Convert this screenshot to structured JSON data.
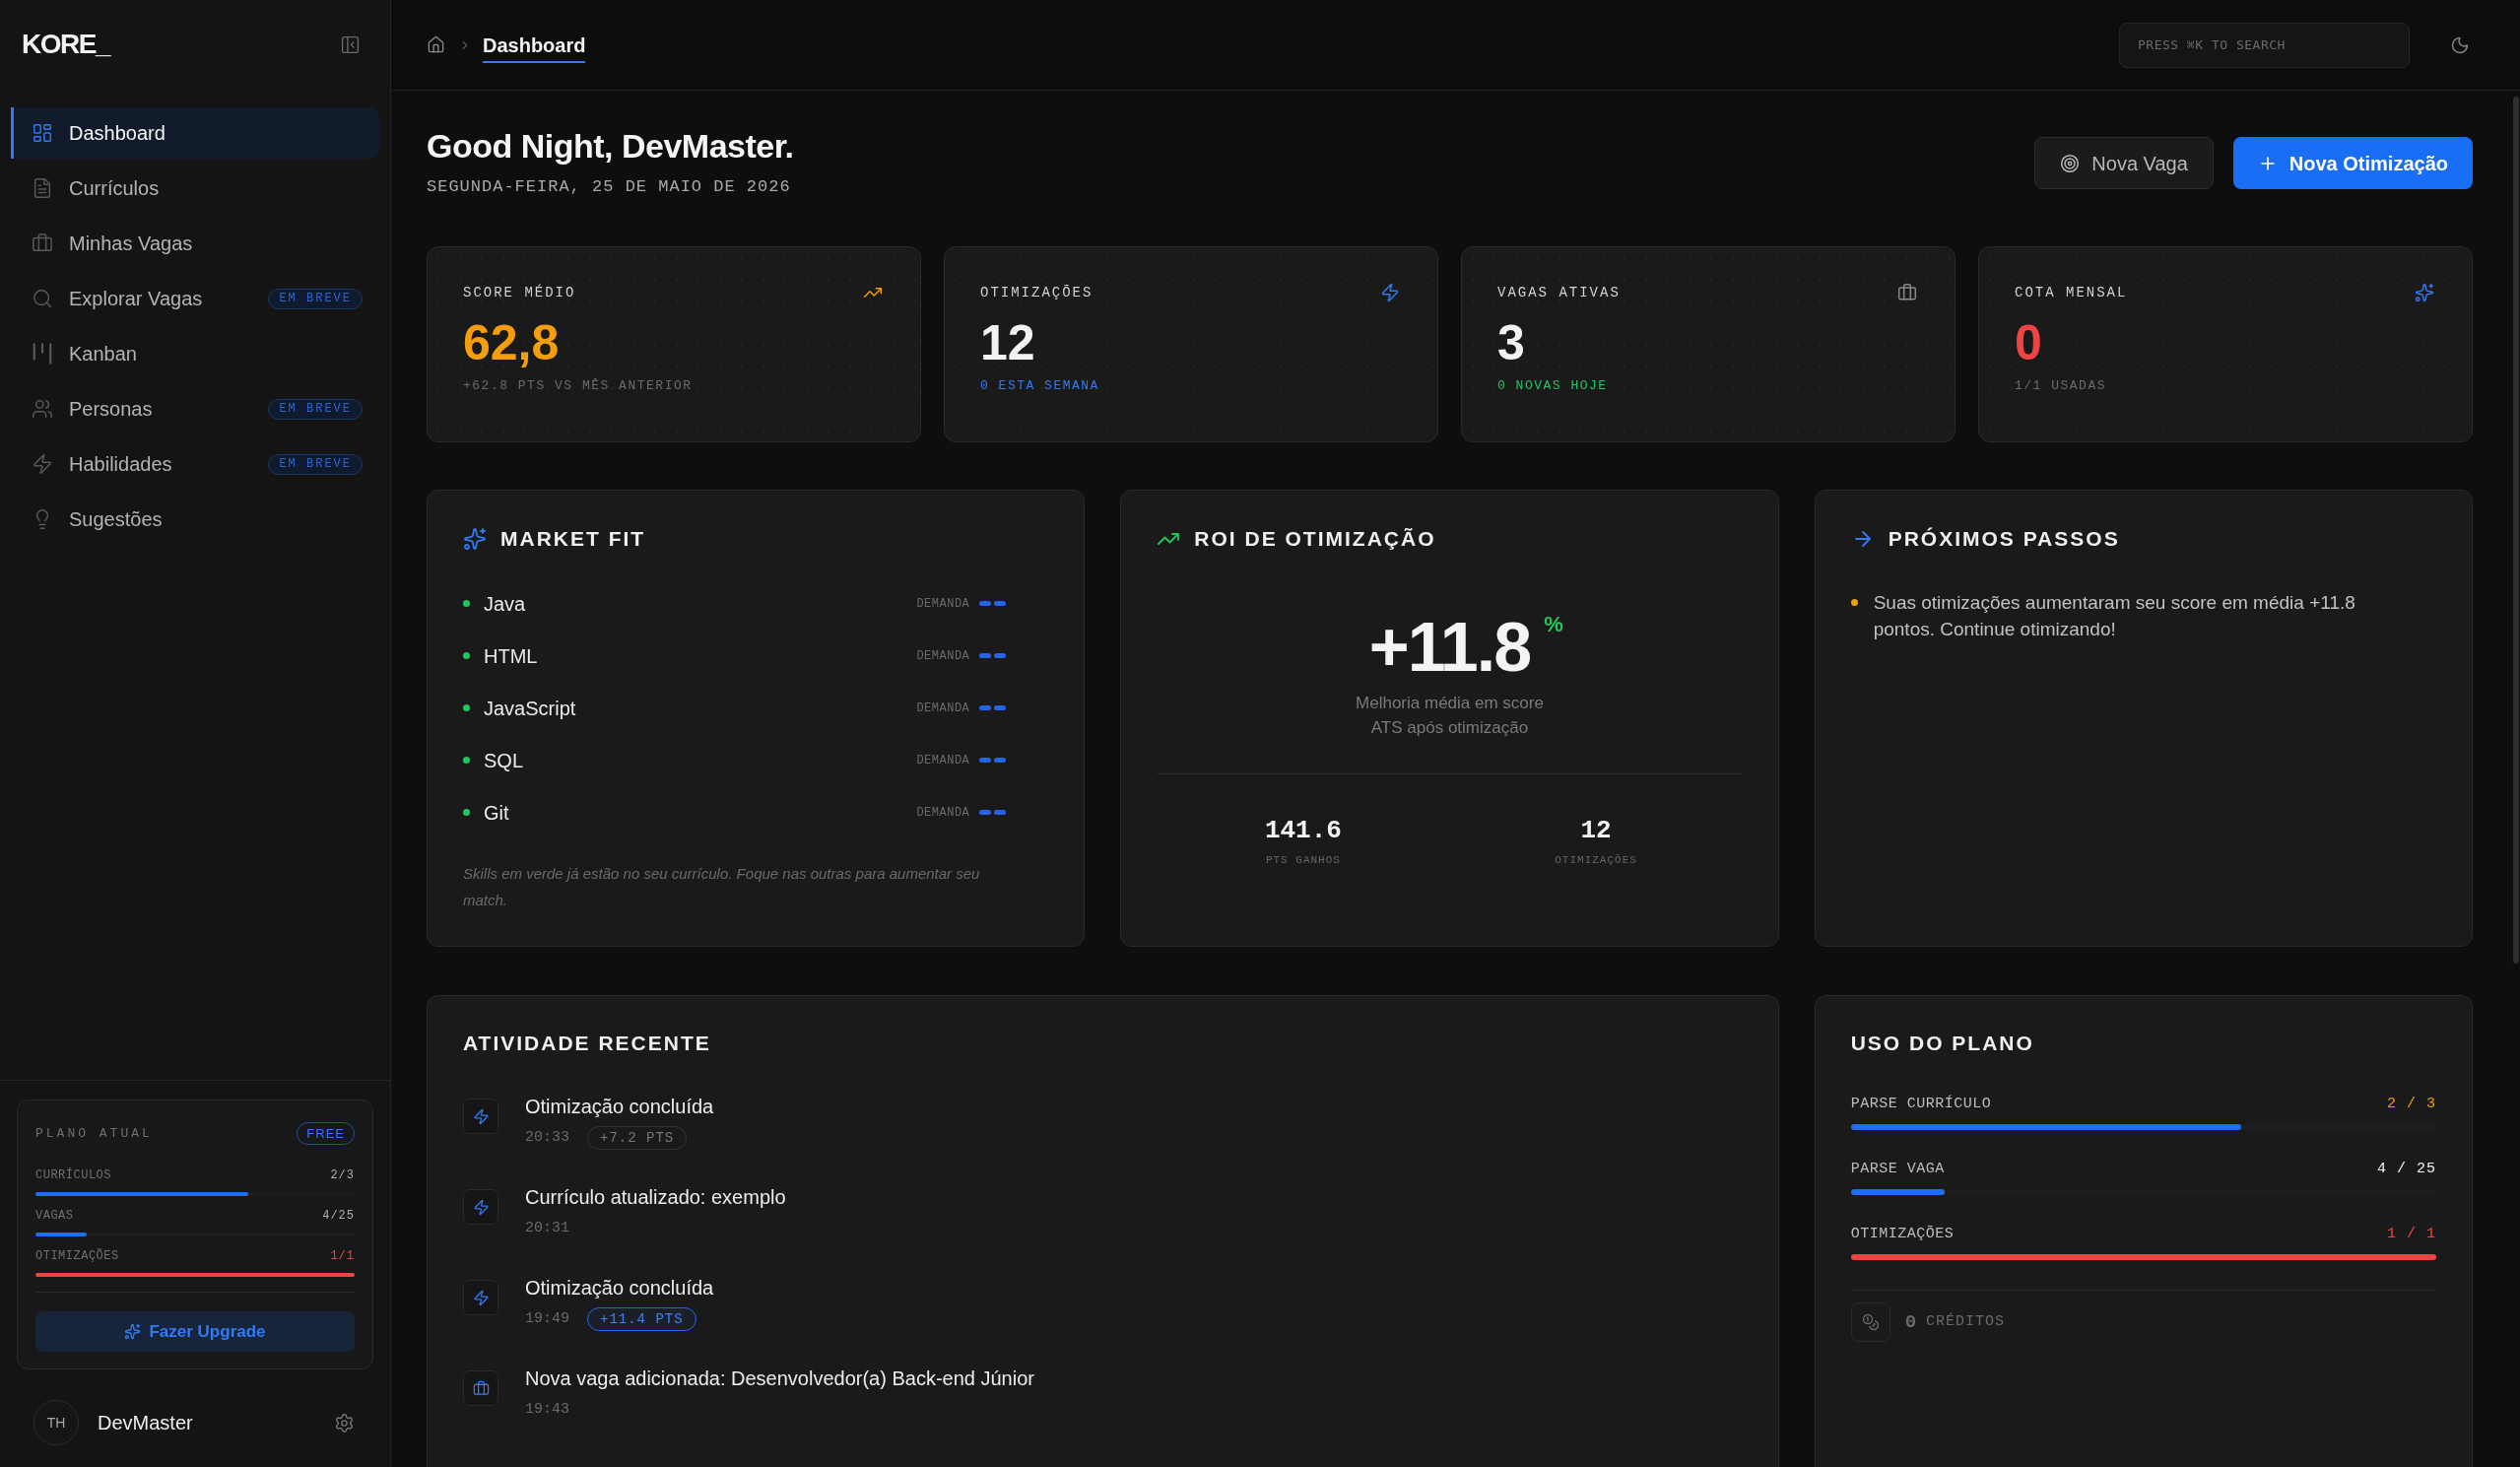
{
  "sidebar": {
    "logo": "KORE_",
    "nav_items": [
      {
        "label": "Dashboard",
        "selected": true
      },
      {
        "label": "Currículos",
        "selected": false
      },
      {
        "label": "Minhas Vagas",
        "selected": false
      },
      {
        "label": "Explorar Vagas",
        "selected": false,
        "badge": "EM BREVE"
      },
      {
        "label": "Kanban",
        "selected": false
      },
      {
        "label": "Personas",
        "selected": false,
        "badge": "EM BREVE"
      },
      {
        "label": "Habilidades",
        "selected": false,
        "badge": "EM BREVE"
      },
      {
        "label": "Sugestões",
        "selected": false
      }
    ],
    "plan_card": {
      "title": "PLANO ATUAL",
      "plan_badge": "FREE",
      "usage": [
        {
          "label": "CURRÍCULOS",
          "value": "2/3",
          "level": 0.667,
          "at_limit": false
        },
        {
          "label": "VAGAS",
          "value": "4/25",
          "level": 0.16,
          "at_limit": false
        },
        {
          "label": "OTIMIZAÇÕES",
          "value": "1/1",
          "level": 1,
          "at_limit": true
        }
      ],
      "upgrade_button": "Fazer Upgrade"
    },
    "user": {
      "initials": "TH",
      "name": "DevMaster"
    }
  },
  "header": {
    "breadcrumb_current": "Dashboard",
    "search": {
      "placeholder": "PRESS ⌘K TO SEARCH"
    }
  },
  "greeting": {
    "title": "Good Night, DevMaster.",
    "date": "SEGUNDA-FEIRA, 25 DE MAIO DE 2026"
  },
  "actions": [
    {
      "label": "Nova Vaga",
      "kind": "secondary"
    },
    {
      "label": "Nova Otimização",
      "kind": "primary"
    }
  ],
  "stats": [
    {
      "kind": "score",
      "label": "SCORE MÉDIO",
      "value": "62,8",
      "note": "+62.8 PTS VS MÊS ANTERIOR"
    },
    {
      "kind": "optimizations",
      "label": "OTIMIZAÇÕES",
      "value": "12",
      "note": "0 ESTA SEMANA"
    },
    {
      "kind": "jobs",
      "label": "VAGAS ATIVAS",
      "value": "3",
      "note": "0 NOVAS HOJE"
    },
    {
      "kind": "quota",
      "label": "COTA MENSAL",
      "value": "0",
      "note": "1/1 USADAS"
    }
  ],
  "market_fit": {
    "title": "MARKET FIT",
    "skills": [
      {
        "name": "Java",
        "in_resume": true,
        "demand_label": "DEMANDA"
      },
      {
        "name": "HTML",
        "in_resume": true,
        "demand_label": "DEMANDA"
      },
      {
        "name": "JavaScript",
        "in_resume": true,
        "demand_label": "DEMANDA"
      },
      {
        "name": "SQL",
        "in_resume": true,
        "demand_label": "DEMANDA"
      },
      {
        "name": "Git",
        "in_resume": true,
        "demand_label": "DEMANDA"
      }
    ],
    "note": "Skills em verde já estão no seu currículo. Foque nas outras para aumentar seu match."
  },
  "roi": {
    "title": "ROI DE OTIMIZAÇÃO",
    "value": "+11.8",
    "unit": "%",
    "caption": "Melhoria média em score ATS após otimização",
    "stats": [
      {
        "value": "141.6",
        "label": "PTS GANHOS"
      },
      {
        "value": "12",
        "label": "OTIMIZAÇÕES"
      }
    ]
  },
  "next_steps": {
    "title": "PRÓXIMOS PASSOS",
    "items": [
      "Suas otimizações aumentaram seu score em média +11.8 pontos. Continue otimizando!"
    ]
  },
  "recent_activity": {
    "title": "ATIVIDADE RECENTE",
    "items": [
      {
        "kind": "optimization",
        "title": "Otimização concluída",
        "time": "20:33",
        "points": {
          "label": "+7.2 PTS",
          "highlighted": false
        }
      },
      {
        "kind": "resume",
        "title": "Currículo atualizado: exemplo",
        "time": "20:31"
      },
      {
        "kind": "optimization",
        "title": "Otimização concluída",
        "time": "19:49",
        "points": {
          "label": "+11.4 PTS",
          "highlighted": true
        }
      },
      {
        "kind": "job",
        "title": "Nova vaga adicionada: Desenvolvedor(a) Back-end Júnior",
        "time": "19:43"
      }
    ]
  },
  "plan_usage": {
    "title": "USO DO PLANO",
    "items": [
      {
        "label": "PARSE CURRÍCULO",
        "value": "2 / 3",
        "level": 0.667,
        "near_limit": true,
        "at_limit": false
      },
      {
        "label": "PARSE VAGA",
        "value": "4 / 25",
        "level": 0.16,
        "near_limit": false,
        "at_limit": false
      },
      {
        "label": "OTIMIZAÇÕES",
        "value": "1 / 1",
        "level": 1,
        "near_limit": false,
        "at_limit": true
      }
    ],
    "credits": {
      "amount": "0",
      "label": "CRÉDITOS"
    }
  }
}
